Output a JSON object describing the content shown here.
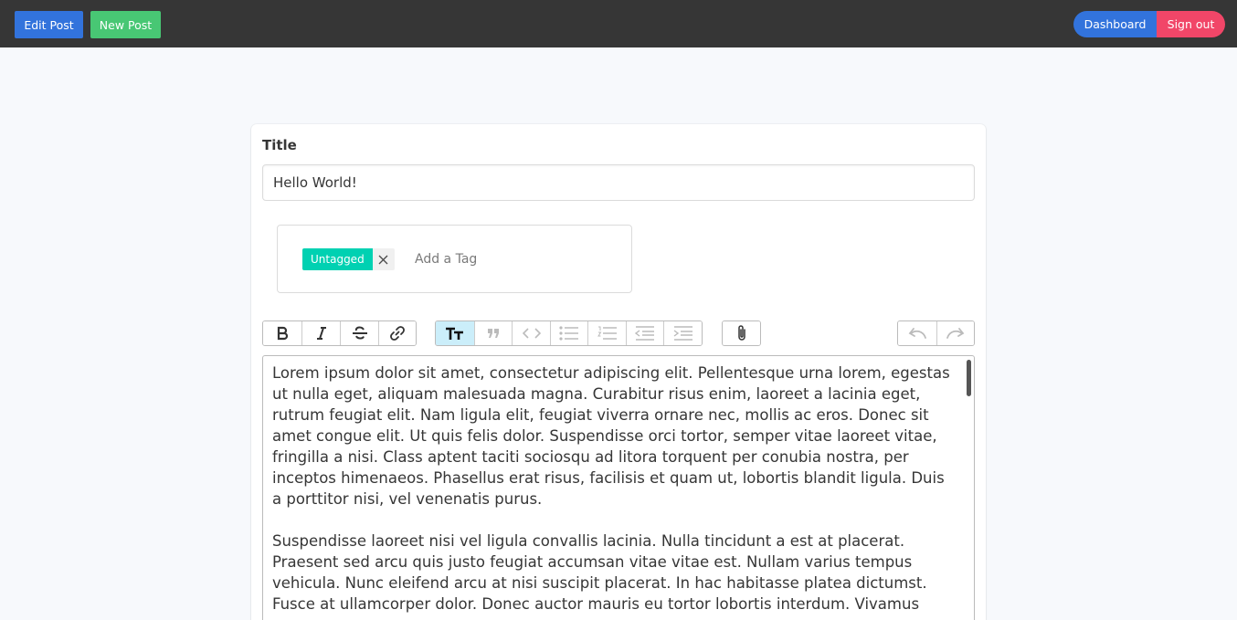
{
  "nav": {
    "edit_post": "Edit Post",
    "new_post": "New Post",
    "dashboard": "Dashboard",
    "sign_out": "Sign out"
  },
  "form": {
    "title_label": "Title",
    "title_value": "Hello World!",
    "tags": [
      "Untagged"
    ],
    "tag_placeholder": "Add a Tag"
  },
  "toolbar": {
    "groups": [
      [
        "bold-icon",
        "italic-icon",
        "strikethrough-icon",
        "link-icon"
      ],
      [
        "heading-icon",
        "quote-icon",
        "code-icon",
        "bullet-list-icon",
        "numbered-list-icon",
        "decrease-indent-icon",
        "increase-indent-icon"
      ],
      [
        "attach-file-icon"
      ],
      [
        "undo-icon",
        "redo-icon"
      ]
    ],
    "active": "heading-icon"
  },
  "editor": {
    "paragraphs": [
      "Lorem ipsum dolor sit amet, consectetur adipiscing elit. Pellentesque urna lorem, egestas ut nulla eget, aliquam malesuada magna. Curabitur risus enim, laoreet a lacinia eget, rutrum feugiat elit. Nam ligula elit, feugiat viverra ornare nec, mollis ac eros. Donec sit amet congue elit. Ut quis felis dolor. Suspendisse orci tortor, semper vitae laoreet vitae, fringilla a nisi. Class aptent taciti sociosqu ad litora torquent per conubia nostra, per inceptos himenaeos. Phasellus erat risus, facilisis et quam ut, lobortis blandit ligula. Duis a porttitor nisi, vel venenatis purus.",
      "Suspendisse laoreet nisi vel ligula convallis lacinia. Nulla tincidunt a est at placerat. Praesent sed arcu quis justo feugiat accumsan vitae vitae est. Nullam varius tempus vehicula. Nunc eleifend arcu at nisi suscipit placerat. In hac habitasse platea dictumst. Fusce at ullamcorper dolor. Donec auctor mauris eu tortor lobortis interdum. Vivamus"
    ]
  },
  "colors": {
    "navbar": "#363636",
    "primary": "#3273dc",
    "success": "#48c774",
    "danger": "#f14668",
    "tag": "#00d1b2",
    "active_tool": "#cbeefa"
  }
}
